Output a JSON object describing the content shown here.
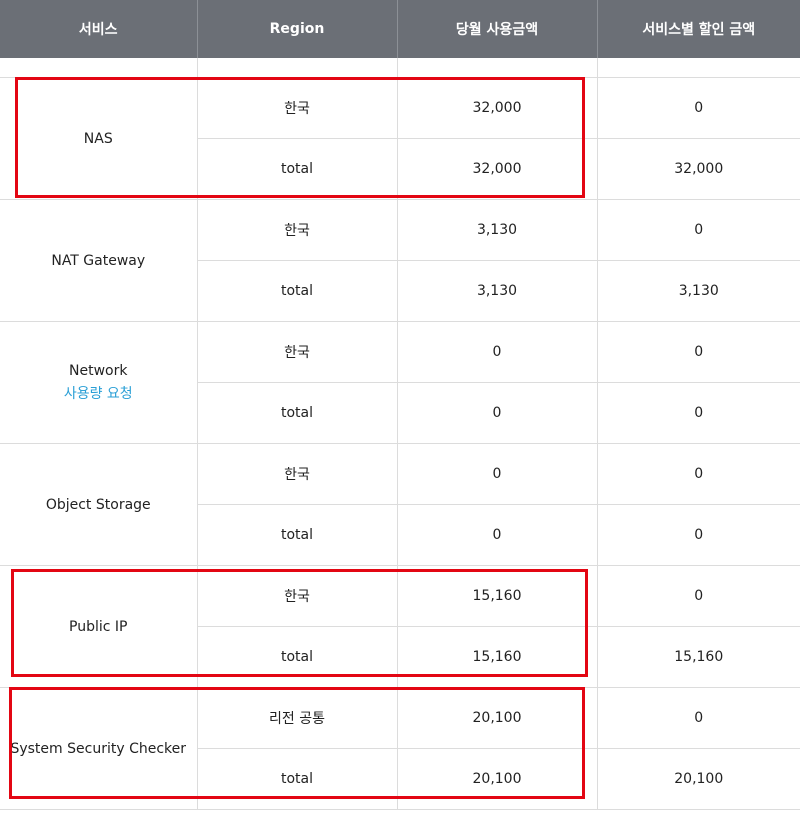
{
  "headers": [
    "서비스",
    "Region",
    "당월 사용금액",
    "서비스별 할인 금액"
  ],
  "rows": {
    "nas": {
      "name": "NAS",
      "r1": {
        "region": "한국",
        "usage": "32,000",
        "discount": "0"
      },
      "r2": {
        "region": "total",
        "usage": "32,000",
        "discount": "32,000"
      }
    },
    "nat": {
      "name": "NAT Gateway",
      "r1": {
        "region": "한국",
        "usage": "3,130",
        "discount": "0"
      },
      "r2": {
        "region": "total",
        "usage": "3,130",
        "discount": "3,130"
      }
    },
    "network": {
      "name": "Network",
      "link": "사용량 요청",
      "r1": {
        "region": "한국",
        "usage": "0",
        "discount": "0"
      },
      "r2": {
        "region": "total",
        "usage": "0",
        "discount": "0"
      }
    },
    "object": {
      "name": "Object Storage",
      "r1": {
        "region": "한국",
        "usage": "0",
        "discount": "0"
      },
      "r2": {
        "region": "total",
        "usage": "0",
        "discount": "0"
      }
    },
    "publicip": {
      "name": "Public IP",
      "r1": {
        "region": "한국",
        "usage": "15,160",
        "discount": "0"
      },
      "r2": {
        "region": "total",
        "usage": "15,160",
        "discount": "15,160"
      }
    },
    "ssc": {
      "name": "System Security Checker",
      "r1": {
        "region": "리전 공통",
        "usage": "20,100",
        "discount": "0"
      },
      "r2": {
        "region": "total",
        "usage": "20,100",
        "discount": "20,100"
      }
    }
  },
  "colors": {
    "header_bg": "#6b6f76",
    "highlight": "#e30613",
    "link": "#2a9fd6"
  }
}
